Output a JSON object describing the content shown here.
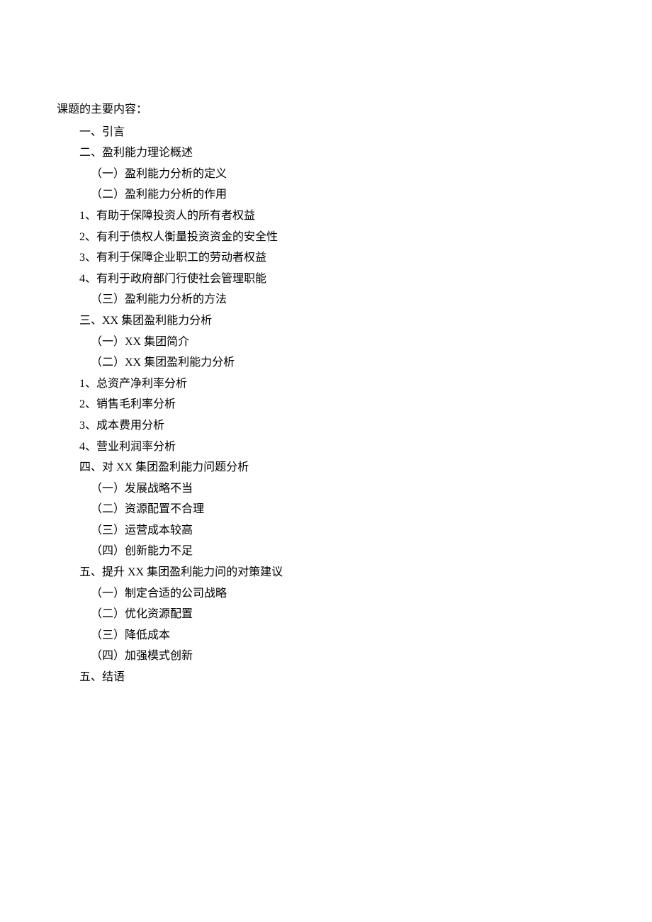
{
  "title": "课题的主要内容：",
  "outline": [
    {
      "text": "一、引言",
      "level": 1
    },
    {
      "text": "二、盈利能力理论概述",
      "level": 1
    },
    {
      "text": "（一）盈利能力分析的定义",
      "level": 2
    },
    {
      "text": "（二）盈利能力分析的作用",
      "level": 2
    },
    {
      "text": "1、有助于保障投资人的所有者权益",
      "level": 1
    },
    {
      "text": "2、有利于债权人衡量投资资金的安全性",
      "level": 1
    },
    {
      "text": "3、有利于保障企业职工的劳动者权益",
      "level": 1
    },
    {
      "text": "4、有利于政府部门行使社会管理职能",
      "level": 1
    },
    {
      "text": "（三）盈利能力分析的方法",
      "level": 2
    },
    {
      "text": "三、XX 集团盈利能力分析",
      "level": 1
    },
    {
      "text": "（一）XX 集团简介",
      "level": 2
    },
    {
      "text": "（二）XX 集团盈利能力分析",
      "level": 2
    },
    {
      "text": "1、总资产净利率分析",
      "level": 1
    },
    {
      "text": "2、销售毛利率分析",
      "level": 1
    },
    {
      "text": "3、成本费用分析",
      "level": 1
    },
    {
      "text": "4、营业利润率分析",
      "level": 1
    },
    {
      "text": "四、对 XX 集团盈利能力问题分析",
      "level": 1
    },
    {
      "text": "（一）发展战略不当",
      "level": 2
    },
    {
      "text": "（二）资源配置不合理",
      "level": 2
    },
    {
      "text": "（三）运营成本较高",
      "level": 2
    },
    {
      "text": "（四）创新能力不足",
      "level": 2
    },
    {
      "text": "五、提升 XX 集团盈利能力问的对策建议",
      "level": 1
    },
    {
      "text": "（一）制定合适的公司战略",
      "level": 2
    },
    {
      "text": "（二）优化资源配置",
      "level": 2
    },
    {
      "text": "（三）降低成本",
      "level": 2
    },
    {
      "text": "（四）加强模式创新",
      "level": 2
    },
    {
      "text": "五、结语",
      "level": 1
    }
  ]
}
